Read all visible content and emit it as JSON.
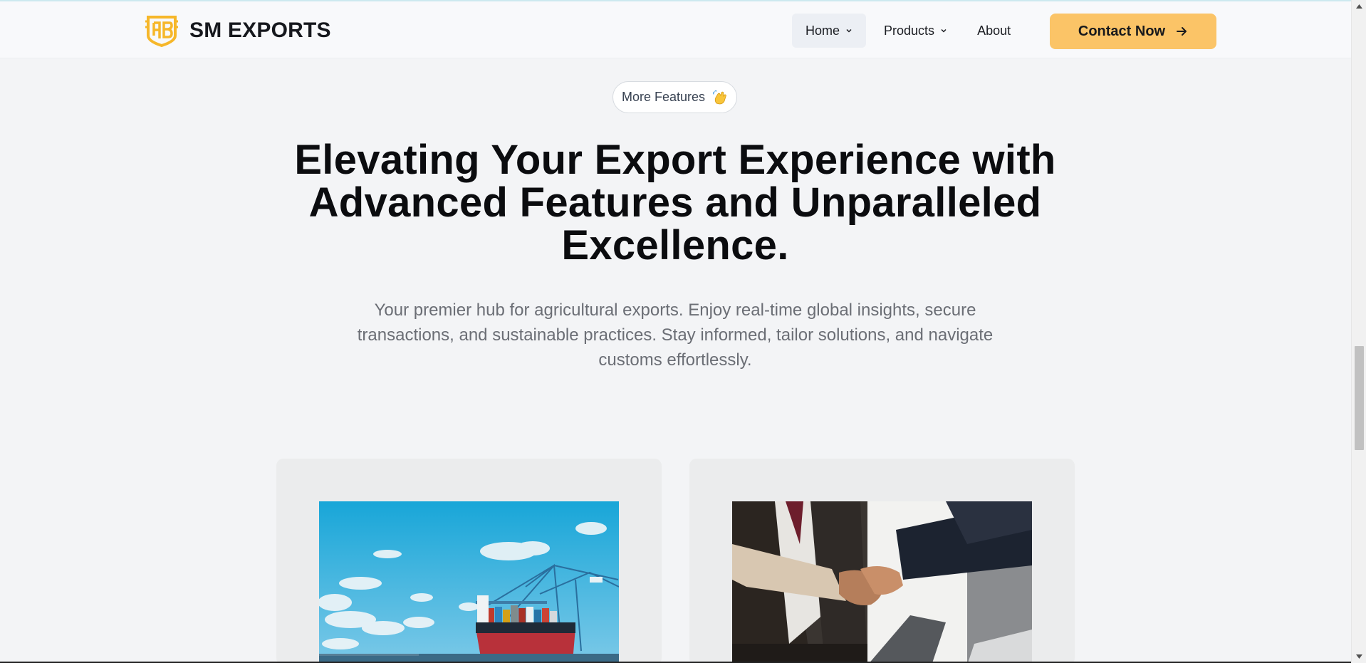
{
  "brand": {
    "name": "SM EXPORTS",
    "accent": "#f6b72a"
  },
  "nav": {
    "items": [
      {
        "label": "Home",
        "has_dropdown": true,
        "active": true
      },
      {
        "label": "Products",
        "has_dropdown": true,
        "active": false
      },
      {
        "label": "About",
        "has_dropdown": false,
        "active": false
      }
    ],
    "cta_label": "Contact Now",
    "cta_color": "#fbc467"
  },
  "badge": {
    "label": "More Features",
    "icon": "waving-hand-icon"
  },
  "hero": {
    "title": "Elevating Your Export Experience with Advanced Features and Unparalleled Excellence.",
    "subtitle": "Your premier hub for agricultural exports. Enjoy real-time global insights, secure transactions, and sustainable practices. Stay informed, tailor solutions, and navigate customs effortlessly."
  },
  "cards": [
    {
      "image": "container-ship-port-image"
    },
    {
      "image": "business-handshake-image"
    }
  ]
}
